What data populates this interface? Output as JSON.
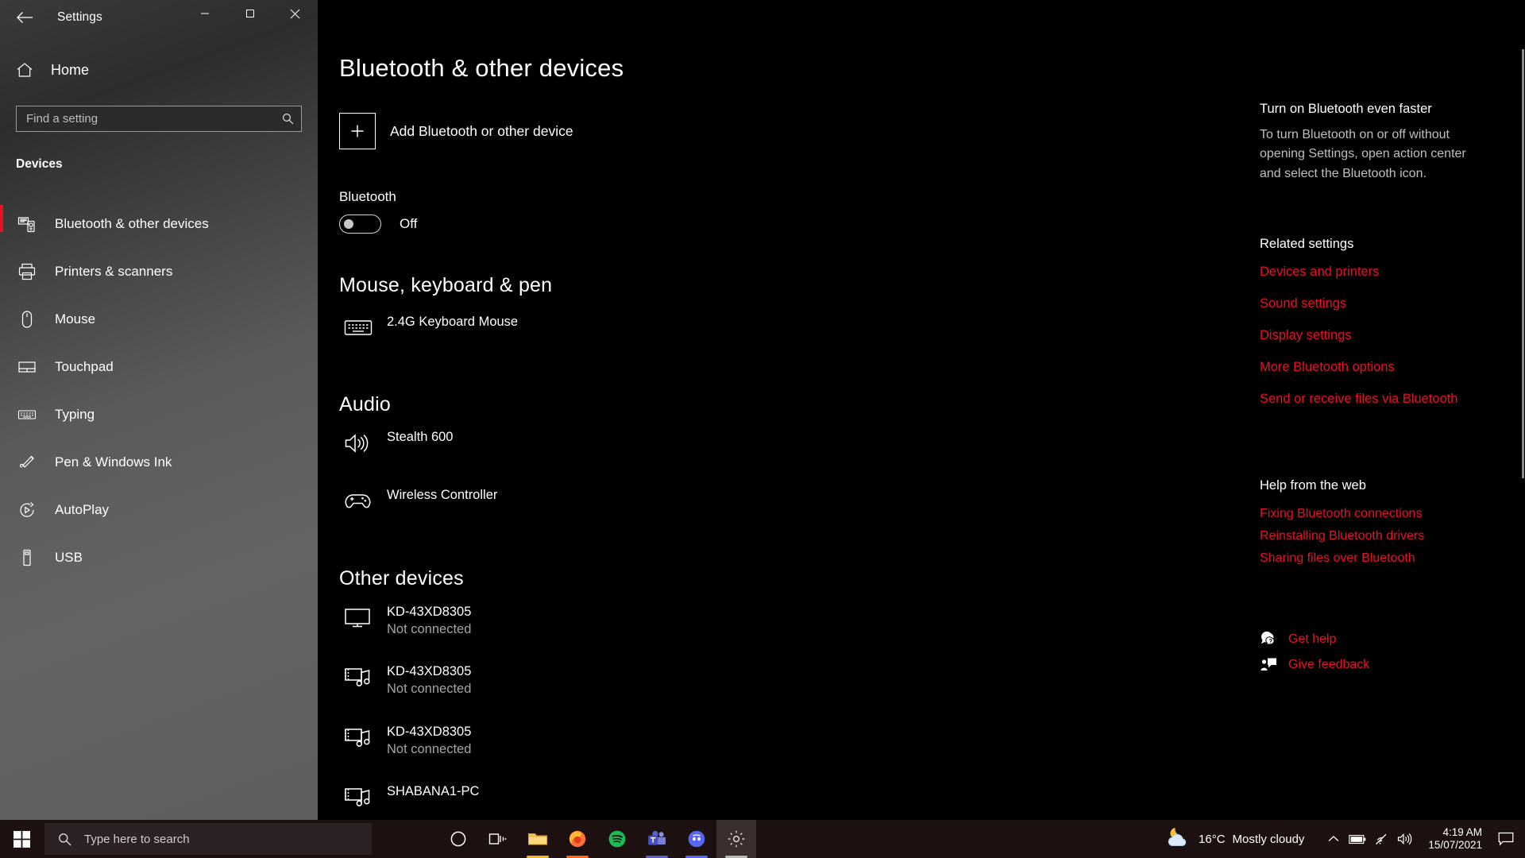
{
  "window": {
    "title": "Settings",
    "back_icon": "back-arrow-icon",
    "minimize": "—",
    "maximize": "▢",
    "close": "✕"
  },
  "sidebar": {
    "home_label": "Home",
    "search": {
      "placeholder": "Find a setting",
      "value": "",
      "icon": "search-icon"
    },
    "group_header": "Devices",
    "items": [
      {
        "label": "Bluetooth & other devices",
        "icon": "bluetooth-devices-icon",
        "active": true
      },
      {
        "label": "Printers & scanners",
        "icon": "printer-icon",
        "active": false
      },
      {
        "label": "Mouse",
        "icon": "mouse-icon",
        "active": false
      },
      {
        "label": "Touchpad",
        "icon": "touchpad-icon",
        "active": false
      },
      {
        "label": "Typing",
        "icon": "keyboard-icon",
        "active": false
      },
      {
        "label": "Pen & Windows Ink",
        "icon": "pen-icon",
        "active": false
      },
      {
        "label": "AutoPlay",
        "icon": "autoplay-icon",
        "active": false
      },
      {
        "label": "USB",
        "icon": "usb-icon",
        "active": false
      }
    ]
  },
  "main": {
    "page_title": "Bluetooth & other devices",
    "add_device": {
      "label": "Add Bluetooth or other device",
      "icon": "plus-icon"
    },
    "bluetooth": {
      "label": "Bluetooth",
      "state": "Off",
      "on": false
    },
    "sections": [
      {
        "header": "Mouse, keyboard & pen",
        "devices": [
          {
            "name": "2.4G Keyboard Mouse",
            "status": "",
            "icon": "keyboard-icon"
          }
        ]
      },
      {
        "header": "Audio",
        "devices": [
          {
            "name": "Stealth 600",
            "status": "",
            "icon": "speaker-icon"
          },
          {
            "name": "Wireless Controller",
            "status": "",
            "icon": "gamepad-icon"
          }
        ]
      },
      {
        "header": "Other devices",
        "devices": [
          {
            "name": "KD-43XD8305",
            "status": "Not connected",
            "icon": "monitor-icon"
          },
          {
            "name": "KD-43XD8305",
            "status": "Not connected",
            "icon": "media-music-icon"
          },
          {
            "name": "KD-43XD8305",
            "status": "Not connected",
            "icon": "media-music-icon"
          },
          {
            "name": "SHABANA1-PC",
            "status": "",
            "icon": "media-music-icon"
          }
        ]
      }
    ]
  },
  "right_panel": {
    "tip_heading": "Turn on Bluetooth even faster",
    "tip_body": "To turn Bluetooth on or off without opening Settings, open action center and select the Bluetooth icon.",
    "related_heading": "Related settings",
    "related_links": [
      "Devices and printers",
      "Sound settings",
      "Display settings",
      "More Bluetooth options",
      "Send or receive files via Bluetooth"
    ],
    "help_heading": "Help from the web",
    "help_links": [
      "Fixing Bluetooth connections",
      "Reinstalling Bluetooth drivers",
      "Sharing files over Bluetooth"
    ],
    "get_help": {
      "label": "Get help",
      "icon": "help-chat-icon"
    },
    "give_feedback": {
      "label": "Give feedback",
      "icon": "feedback-icon"
    },
    "link_color": "#e81123"
  },
  "taskbar": {
    "start_icon": "windows-start-icon",
    "search_placeholder": "Type here to search",
    "search_icon": "search-icon",
    "apps": [
      {
        "name": "cortana-icon",
        "accent": ""
      },
      {
        "name": "task-view-icon",
        "accent": ""
      },
      {
        "name": "file-explorer-icon",
        "accent": "#f0b429"
      },
      {
        "name": "firefox-icon",
        "accent": "#ff6611"
      },
      {
        "name": "spotify-icon",
        "accent": "#1db954"
      },
      {
        "name": "microsoft-teams-icon",
        "accent": "#5b5fc7"
      },
      {
        "name": "discord-icon",
        "accent": "#5865f2"
      },
      {
        "name": "settings-gear-icon",
        "accent": "#9a9a9a"
      }
    ],
    "weather": {
      "temperature": "16°C",
      "condition": "Mostly cloudy",
      "icon": "moon-cloud-icon"
    },
    "tray_icons": [
      "chevron-up-icon",
      "battery-icon",
      "wifi-icon",
      "volume-icon"
    ],
    "time": "4:19 AM",
    "date": "15/07/2021",
    "action_center_icon": "action-center-icon"
  }
}
